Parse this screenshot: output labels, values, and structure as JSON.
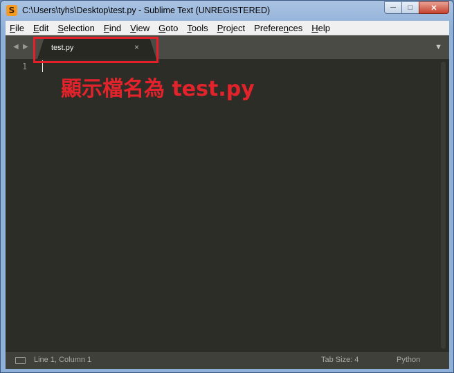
{
  "window": {
    "title": "C:\\Users\\tyhs\\Desktop\\test.py - Sublime Text (UNREGISTERED)",
    "app_icon_glyph": "S",
    "buttons": {
      "minimize": "─",
      "maximize": "□",
      "close": "✕"
    }
  },
  "menu": {
    "items": [
      {
        "label": "File",
        "mnemonic": "F",
        "rest": "ile"
      },
      {
        "label": "Edit",
        "mnemonic": "E",
        "rest": "dit"
      },
      {
        "label": "Selection",
        "mnemonic": "S",
        "rest": "election"
      },
      {
        "label": "Find",
        "mnemonic": "F",
        "rest": "ind"
      },
      {
        "label": "View",
        "mnemonic": "V",
        "rest": "iew"
      },
      {
        "label": "Goto",
        "mnemonic": "G",
        "rest": "oto"
      },
      {
        "label": "Tools",
        "mnemonic": "T",
        "rest": "ools"
      },
      {
        "label": "Project",
        "mnemonic": "P",
        "rest": "roject"
      },
      {
        "label": "Preferences",
        "mnemonic": "n",
        "pre": "Prefere",
        "rest": "ces"
      },
      {
        "label": "Help",
        "mnemonic": "H",
        "rest": "elp"
      }
    ]
  },
  "tabs": {
    "nav_left": "◀",
    "nav_right": "▶",
    "active": {
      "label": "test.py",
      "close_glyph": "×"
    },
    "dropdown_glyph": "▼"
  },
  "editor": {
    "line_numbers": [
      "1"
    ],
    "annotation": "顯示檔名為 test.py"
  },
  "status": {
    "position": "Line 1, Column 1",
    "tab_size": "Tab Size: 4",
    "syntax": "Python"
  },
  "colors": {
    "highlight": "#e5202a",
    "editor_bg": "#2c2d27"
  }
}
